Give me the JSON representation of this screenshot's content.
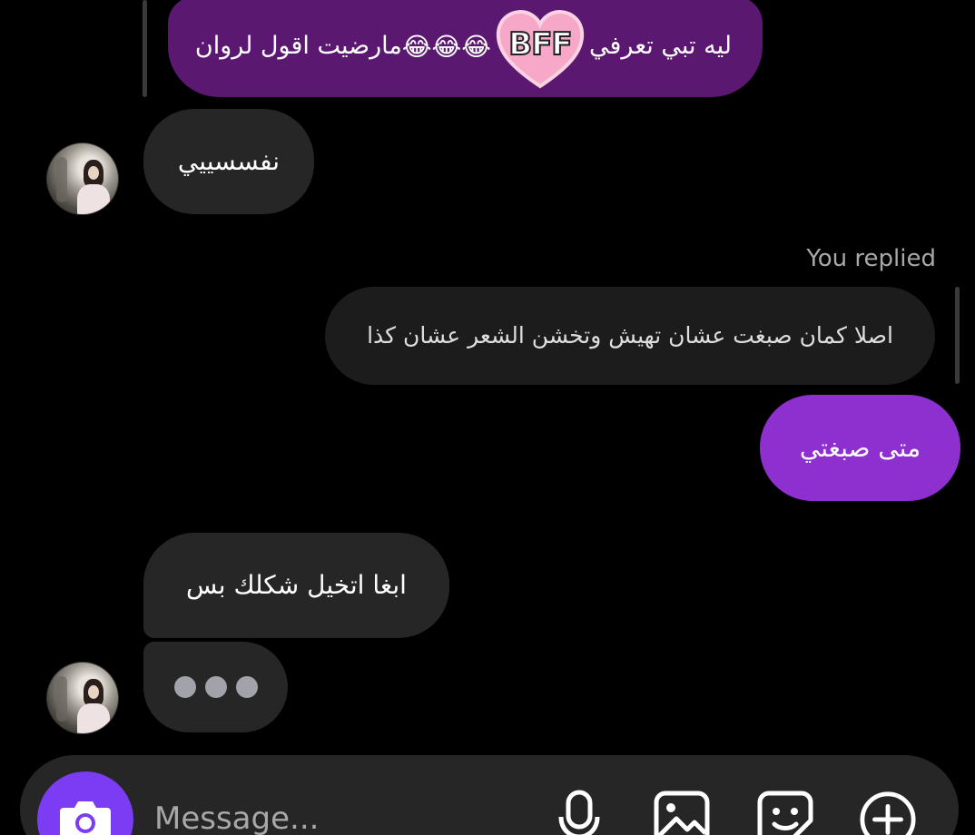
{
  "thread": {
    "quoted_message": {
      "text_right": "ليه تبي تعرفي",
      "sticker_text": "BFF",
      "emojis": "😂😂😂",
      "text_left": "مارضيت اقول لروان"
    },
    "messages": [
      {
        "sender": "other",
        "text": "نفسسييي"
      },
      {
        "sender": "me",
        "reply_label": "You replied",
        "reply_to_text": "اصلا كمان صبغت عشان تهيش وتخشن الشعر عشان كذا"
      },
      {
        "sender": "me",
        "text": "متى صبغتي"
      },
      {
        "sender": "other",
        "text": "ابغا اتخيل شكلك بس"
      }
    ],
    "typing_indicator": "typing-dots"
  },
  "composer": {
    "placeholder": "Message...",
    "icons": [
      "camera-icon",
      "microphone-icon",
      "gallery-icon",
      "sticker-icon",
      "plus-circle-icon"
    ]
  },
  "colors": {
    "background": "#000000",
    "incoming_bubble": "#262626",
    "outgoing_bubble": "#8e2fd0",
    "quoted_bubble": "#5b1870",
    "camera_button": "#7b3cf3"
  }
}
